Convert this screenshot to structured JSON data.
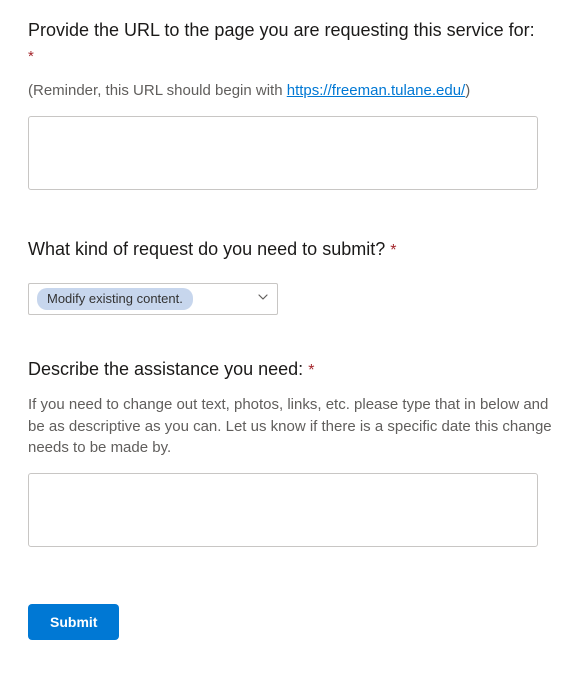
{
  "fields": {
    "url": {
      "label": "Provide the URL to the page you are requesting this service for:",
      "reminder_prefix": "(Reminder, this URL should begin with ",
      "reminder_link_text": "https://freeman.tulane.edu/",
      "reminder_suffix": ")",
      "value": ""
    },
    "request_type": {
      "label": "What kind of request do you need to submit?",
      "selected": "Modify existing content."
    },
    "assistance": {
      "label": "Describe the assistance you need:",
      "helper": "If you need to change out text, photos, links, etc. please type that in below and be as descriptive as you can. Let us know if there is a specific date this change needs to be made by.",
      "value": ""
    }
  },
  "required_marker": "*",
  "submit_label": "Submit"
}
